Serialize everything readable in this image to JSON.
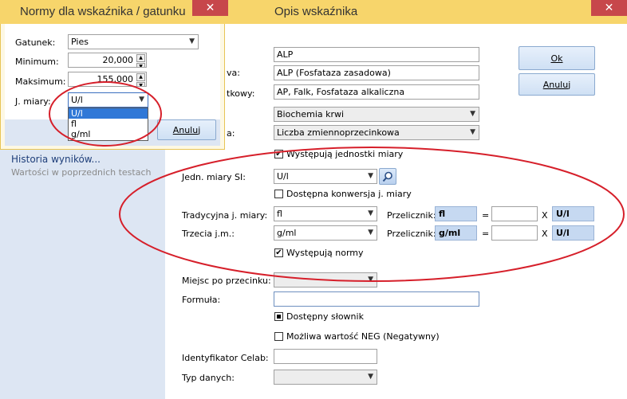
{
  "main": {
    "title": "Opis wskaźnika",
    "close": "✕",
    "rows": {
      "code_value": "ALP",
      "name_label": "va:",
      "name_value": "ALP (Fosfataza zasadowa)",
      "short_label": "tkowy:",
      "short_value": "AP, Falk, Fosfataza alkaliczna",
      "group_value": "Biochemia krwi",
      "type_label": "a:",
      "type_value": "Liczba zmiennoprzecinkowa"
    },
    "units_checkbox_label": "Występują jednostki miary",
    "si_label": "Jedn. miary SI:",
    "si_value": "U/l",
    "conversion_label": "Dostępna konwersja j. miary",
    "traditional_label": "Tradycyjna j. miary:",
    "traditional_value": "fl",
    "third_label": "Trzecia j.m.:",
    "third_value": "g/ml",
    "converter_label": "Przelicznik:",
    "conv1": {
      "from": "fl",
      "eq": "=",
      "x": "X",
      "to": "U/l"
    },
    "conv2": {
      "from": "g/ml",
      "eq": "=",
      "x": "X",
      "to": "U/l"
    },
    "norms_label": "Występują normy",
    "decimals_label": "Miejsc po przecinku:",
    "formula_label": "Formuła:",
    "dictionary_label": "Dostępny słownik",
    "neg_label": "Możliwa wartość NEG (Negatywny)",
    "celab_label": "Identyfikator Celab:",
    "datatype_label": "Typ danych:",
    "ok_label": "Ok",
    "cancel_label": "Anuluj"
  },
  "left": {
    "history_link": "Historia wyników...",
    "history_sub": "Wartości w poprzednich testach"
  },
  "norms": {
    "title": "Normy dla wskaźnika / gatunku",
    "close": "✕",
    "species_label": "Gatunek:",
    "species_value": "Pies",
    "min_label": "Minimum:",
    "min_value": "20,000",
    "max_label": "Maksimum:",
    "max_value": "155,000",
    "unit_label": "J. miary:",
    "unit_value": "U/l",
    "unit_options": [
      "U/l",
      "fl",
      "g/ml"
    ],
    "cancel_label": "Anuluj"
  }
}
